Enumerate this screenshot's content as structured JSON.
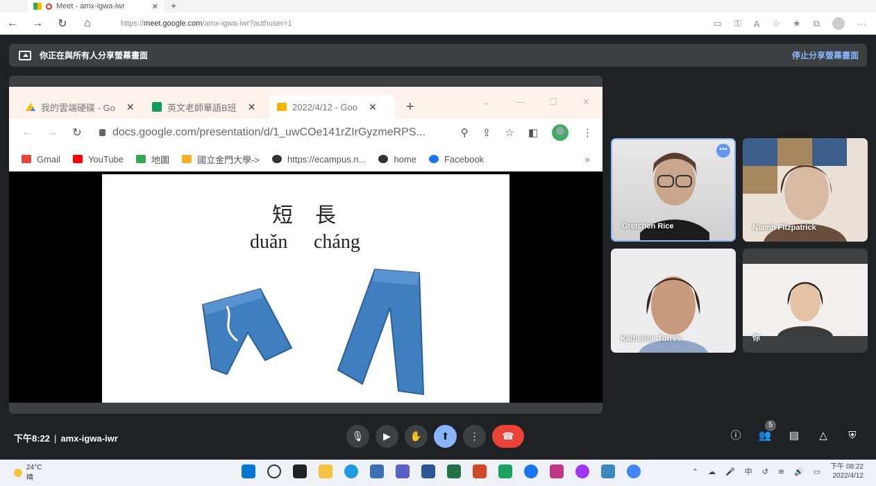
{
  "edge": {
    "tab_title": "Meet - amx-igwa-iwr",
    "url_prefix": "https://",
    "url_host": "meet.google.com",
    "url_path": "/amx-igwa-iwr?authuser=1"
  },
  "banner": {
    "sharing_text": "你正在與所有人分享螢幕畫面",
    "stop_label": "停止分享螢幕畫面"
  },
  "shared_browser": {
    "tabs": [
      {
        "title": "我的雲端硬碟 - Go",
        "icon": "google-drive-icon"
      },
      {
        "title": "英文老師華語B班",
        "icon": "google-sheets-icon"
      },
      {
        "title": "2022/4/12 - Goo",
        "icon": "google-slides-icon"
      }
    ],
    "url": "docs.google.com/presentation/d/1_uwCOe141rZIrGyzmeRPS...",
    "bookmarks": [
      "Gmail",
      "YouTube",
      "地圖",
      "國立金門大學->",
      "https://ecampus.n...",
      "home",
      "Facebook"
    ]
  },
  "slide": {
    "word1_hanzi": "短",
    "word2_hanzi": "長",
    "word1_pinyin": "duǎn",
    "word2_pinyin": "cháng"
  },
  "participants": [
    {
      "name": "Gretchen Rice"
    },
    {
      "name": "Niamh Fitzpatrick"
    },
    {
      "name": "Katherine Torres"
    },
    {
      "name": "你"
    }
  ],
  "meeting": {
    "time": "下午8:22",
    "code": "amx-igwa-iwr",
    "participant_count": "5"
  },
  "taskbar": {
    "weather_temp": "24°C",
    "weather_desc": "晴",
    "ime": "中",
    "clock_time": "下午 08:22",
    "clock_date": "2022/4/12"
  }
}
